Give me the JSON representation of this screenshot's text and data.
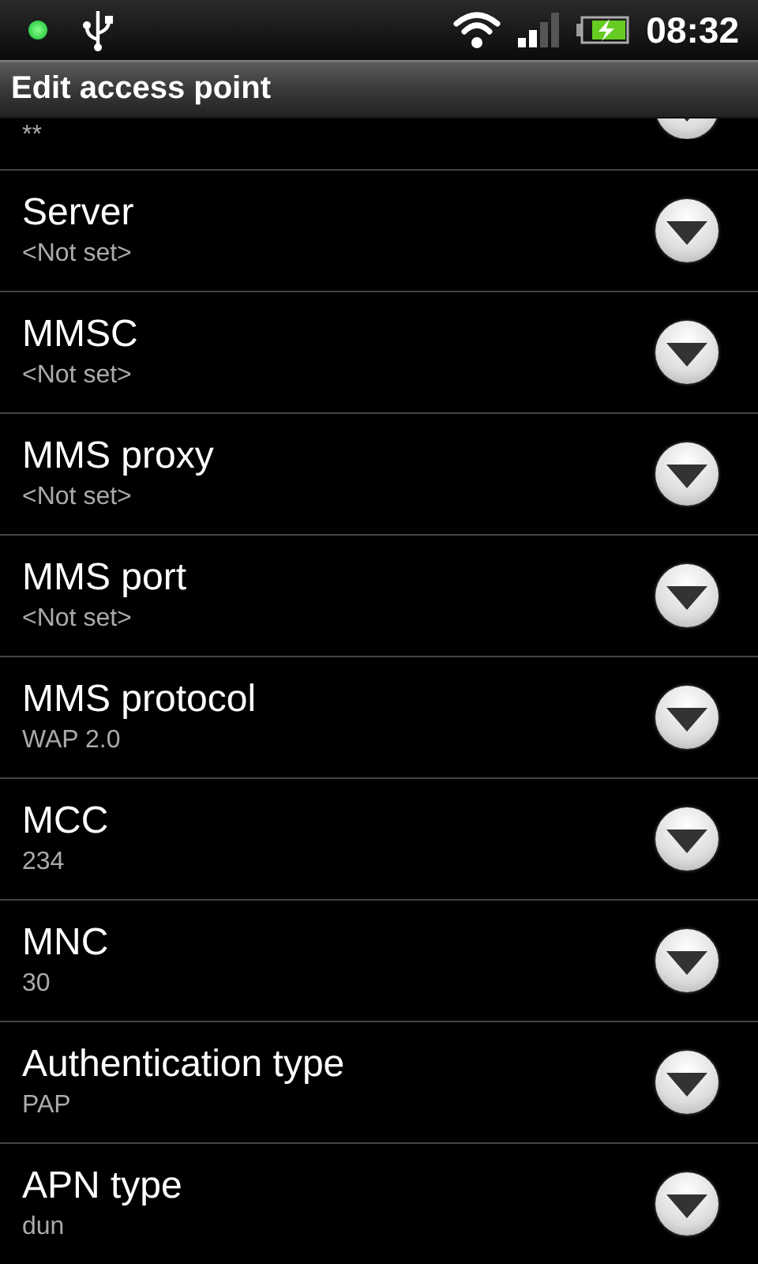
{
  "status_bar": {
    "time": "08:32"
  },
  "title_bar": {
    "title": "Edit access point"
  },
  "partial_row": {
    "value": "**"
  },
  "settings": [
    {
      "label": "Server",
      "value": "<Not set>"
    },
    {
      "label": "MMSC",
      "value": "<Not set>"
    },
    {
      "label": "MMS proxy",
      "value": "<Not set>"
    },
    {
      "label": "MMS port",
      "value": "<Not set>"
    },
    {
      "label": "MMS protocol",
      "value": "WAP 2.0"
    },
    {
      "label": "MCC",
      "value": "234"
    },
    {
      "label": "MNC",
      "value": "30"
    },
    {
      "label": "Authentication type",
      "value": "PAP"
    },
    {
      "label": "APN type",
      "value": "dun"
    }
  ]
}
